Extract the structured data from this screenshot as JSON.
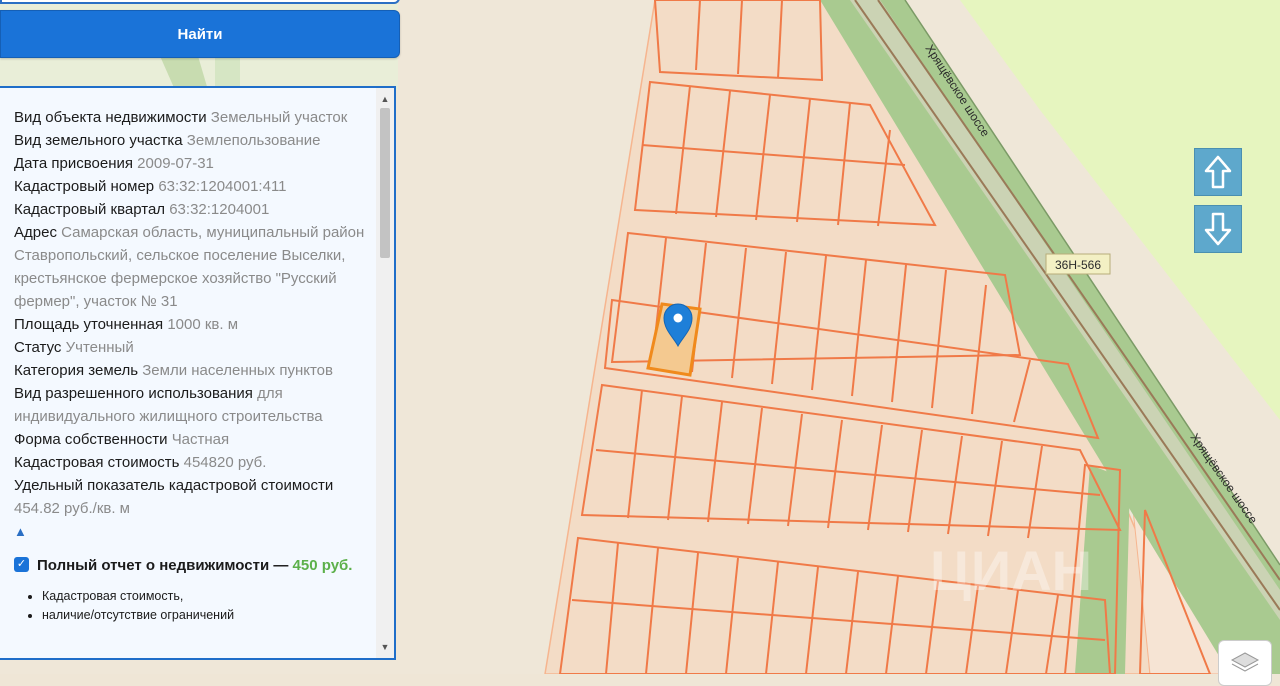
{
  "search": {
    "button_label": "Найти"
  },
  "property": {
    "fields": [
      {
        "label": "Вид объекта недвижимости",
        "value": "Земельный участок"
      },
      {
        "label": "Вид земельного участка",
        "value": "Землепользование"
      },
      {
        "label": "Дата присвоения",
        "value": "2009-07-31"
      },
      {
        "label": "Кадастровый номер",
        "value": "63:32:1204001:411"
      },
      {
        "label": "Кадастровый квартал",
        "value": "63:32:1204001"
      },
      {
        "label": "Адрес",
        "value": "Самарская область, муниципальный район Ставропольский, сельское поселение Выселки, крестьянское фермерское хозяйство \"Русский фермер\", участок № 31"
      },
      {
        "label": "Площадь уточненная",
        "value": "1000 кв. м"
      },
      {
        "label": "Статус",
        "value": "Учтенный"
      },
      {
        "label": "Категория земель",
        "value": "Земли населенных пунктов"
      },
      {
        "label": "Вид разрешенного использования",
        "value": "для индивидуального жилищного строительства"
      },
      {
        "label": "Форма собственности",
        "value": "Частная"
      },
      {
        "label": "Кадастровая стоимость",
        "value": "454820 руб."
      },
      {
        "label": "Удельный показатель кадастровой стоимости",
        "value": "454.82 руб./кв. м"
      }
    ],
    "collapse_glyph": "▲"
  },
  "report": {
    "checked": true,
    "label": "Полный отчет о недвижимости —",
    "price": "450 руб.",
    "items": [
      "Кадастровая стоимость,",
      "наличие/отсутствие ограничений"
    ]
  },
  "map": {
    "road_name": "Хрящёвское шоссе",
    "road_code": "36Н-566",
    "watermark": "ЦИАН",
    "zoom_controls": {
      "up_icon": "arrow-up-icon",
      "down_icon": "arrow-down-icon"
    },
    "layers_icon": "layers-icon"
  },
  "colors": {
    "accent": "#1a73d8",
    "plot_fill": "#f6dcc4",
    "plot_stroke": "#f07a48",
    "selected_plot_stroke": "#f08a1c",
    "marker": "#1e7fd8",
    "field_green": "#e6f5bf",
    "road_green": "#a9ca90",
    "price_green": "#5cb04a"
  }
}
